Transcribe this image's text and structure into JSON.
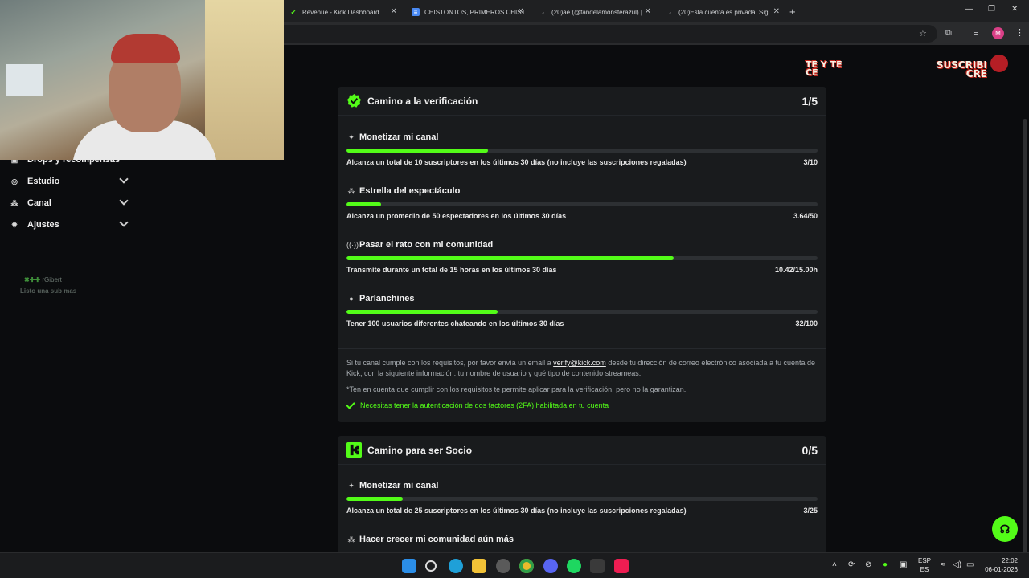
{
  "browser": {
    "tabs": [
      {
        "label": "Revenue - Kick Dashboard",
        "icon": "kick-icon"
      },
      {
        "label": "CHISTONTOS, PRIMEROS CHIST",
        "icon": "docs-icon"
      },
      {
        "label": "(20)ae (@fandelamonsterazul) |",
        "icon": "tiktok-icon"
      },
      {
        "label": "(20)Esta cuenta es privada. Sig",
        "icon": "tiktok-icon"
      }
    ],
    "new_tab": "+",
    "profile_initial": "M"
  },
  "sidebar": {
    "items": [
      {
        "label": "Drops y recompensas",
        "icon": "gift-icon"
      },
      {
        "label": "Estudio",
        "icon": "studio-icon"
      },
      {
        "label": "Canal",
        "icon": "channel-icon"
      },
      {
        "label": "Ajustes",
        "icon": "gear-icon"
      }
    ],
    "overlay_name": "rGibert",
    "overlay_text": "Listo una sub mas"
  },
  "banners": {
    "left": "TE Y TE\nCE",
    "right": "SUSCRIBI\nCRE"
  },
  "verification": {
    "title": "Camino a la verificación",
    "count": "1/5",
    "requirements": [
      {
        "title": "Monetizar mi canal",
        "icon": "sparkle-icon",
        "desc": "Alcanza un total de 10 suscriptores en los últimos 30 días (no incluye las suscripciones regaladas)",
        "value": "3/10",
        "progress": 0.3
      },
      {
        "title": "Estrella del espectáculo",
        "icon": "users-icon",
        "desc": "Alcanza un promedio de 50 espectadores en los últimos 30 días",
        "value": "3.64/50",
        "progress": 0.0728
      },
      {
        "title": "Pasar el rato con mi comunidad",
        "icon": "broadcast-icon",
        "desc": "Transmite durante un total de 15 horas en los últimos 30 días",
        "value": "10.42/15.00h",
        "progress": 0.6947
      },
      {
        "title": "Parlanchines",
        "icon": "chat-icon",
        "desc": "Tener 100 usuarios diferentes chateando en los últimos 30 días",
        "value": "32/100",
        "progress": 0.32
      }
    ],
    "info_prefix": "Si tu canal cumple con los requisitos, por favor envía un email a",
    "info_email": "verify@kick.com",
    "info_suffix": "desde tu dirección de correo electrónico asociada a tu cuenta de Kick, con la siguiente información: tu nombre de usuario y qué tipo de contenido streameas.",
    "disclaimer": "*Ten en cuenta que cumplir con los requisitos te permite aplicar para la verificación, pero no la garantizan.",
    "twofa": "Necesitas tener la autenticación de dos factores (2FA) habilitada en tu cuenta"
  },
  "partner": {
    "title": "Camino para ser Socio",
    "count": "0/5",
    "requirements": [
      {
        "title": "Monetizar mi canal",
        "icon": "sparkle-icon",
        "desc": "Alcanza un total de 25 suscriptores en los últimos 30 días (no incluye las suscripciones regaladas)",
        "value": "3/25",
        "progress": 0.12
      },
      {
        "title": "Hacer crecer mi comunidad aún más",
        "icon": "users-icon"
      }
    ]
  },
  "taskbar": {
    "lang_top": "ESP",
    "lang_bottom": "ES",
    "time": "22:02",
    "date": "06-01-2026"
  },
  "colors": {
    "accent": "#53fc18",
    "card": "#191b1d",
    "background": "#0b0c0e"
  }
}
